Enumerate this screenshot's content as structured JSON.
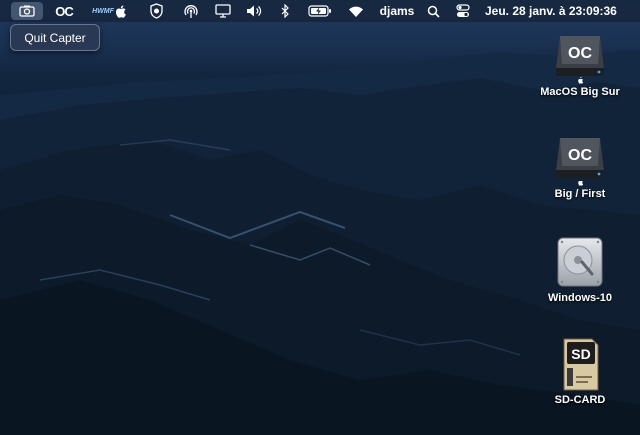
{
  "menubar": {
    "capter_icon": "camera-icon",
    "oc_label": "OC",
    "hwmonitor_label": "HWMF",
    "apple_icon": "apple-icon",
    "vpn_icon": "vpn-shield-icon",
    "airdrop_icon": "airdrop-icon",
    "display_icon": "display-icon",
    "volume_icon": "volume-icon",
    "bluetooth_icon": "bluetooth-icon",
    "battery_icon": "battery-charging-icon",
    "wifi_icon": "wifi-icon",
    "user_name": "djams",
    "search_icon": "search-icon",
    "control_center_icon": "control-center-icon",
    "clock": "Jeu. 28 janv. à  23:09:36"
  },
  "tooltip": {
    "text": "Quit Capter"
  },
  "desktop_icons": [
    {
      "label": "MacOS Big Sur",
      "icon": "opencore-drive-icon"
    },
    {
      "label": "Big / First",
      "icon": "opencore-drive-icon"
    },
    {
      "label": "Windows-10",
      "icon": "internal-hard-drive-icon"
    },
    {
      "label": "SD-CARD",
      "icon": "sd-card-icon"
    }
  ],
  "colors": {
    "menubar_bg": "#16243a",
    "sky_top": "#1f3a60",
    "mountains": "#0c1928"
  }
}
